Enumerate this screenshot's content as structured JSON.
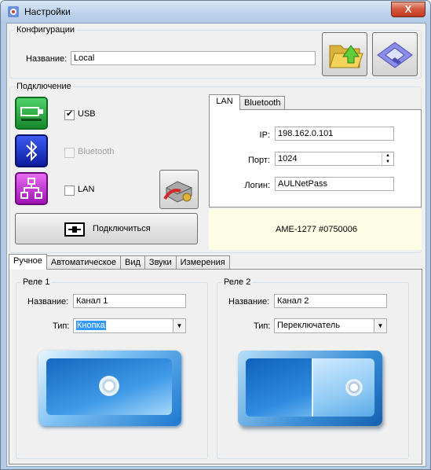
{
  "window": {
    "title": "Настройки",
    "close_label": "X"
  },
  "config": {
    "group_title": "Конфигурации",
    "name_label": "Название:",
    "name_value": "Local"
  },
  "connection": {
    "group_title": "Подключение",
    "usb_label": "USB",
    "usb_checked": true,
    "bluetooth_label": "Bluetooth",
    "bluetooth_checked": false,
    "lan_label": "LAN",
    "lan_checked": false,
    "connect_label": "Подключиться"
  },
  "net_tabs": [
    "LAN",
    "Bluetooth"
  ],
  "lan": {
    "ip_label": "IP:",
    "ip_value": "198.162.0.101",
    "port_label": "Порт:",
    "port_value": "1024",
    "login_label": "Логин:",
    "login_value": "AULNetPass"
  },
  "device_status": "AME-1277 #0750006",
  "main_tabs": [
    "Ручное",
    "Автоматическое",
    "Вид",
    "Звуки",
    "Измерения"
  ],
  "relay1": {
    "title": "Реле 1",
    "name_label": "Название:",
    "name_value": "Канал 1",
    "type_label": "Тип:",
    "type_value": "Кнопка"
  },
  "relay2": {
    "title": "Реле 2",
    "name_label": "Название:",
    "name_value": "Канал 2",
    "type_label": "Тип:",
    "type_value": "Переключатель"
  },
  "icons": {
    "open_folder": "folder-open-icon",
    "save": "floppy-save-icon",
    "usb_tile": "usb-icon",
    "bluetooth_tile": "bluetooth-icon",
    "lan_tile": "network-icon",
    "network_settings": "network-settings-icon",
    "plug": "plug-icon"
  },
  "colors": {
    "usb_tile": "#1fa43a",
    "bluetooth_tile": "#2234c8",
    "lan_tile": "#c42ad0",
    "status_bg": "#fdfde6",
    "relay_blue": "#1f7fd6"
  }
}
